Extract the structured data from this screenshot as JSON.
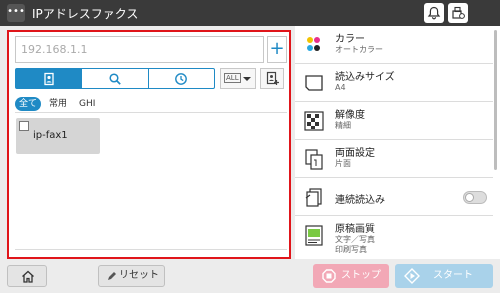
{
  "header": {
    "title": "IPアドレスファクス",
    "menu_icon": "ellipsis-icon",
    "right_icons": [
      "bell-icon",
      "fax-status-icon"
    ]
  },
  "address": {
    "input_value": "192.168.1.1",
    "add_label": "+"
  },
  "view_tabs": [
    {
      "icon": "address-book-icon",
      "active": true
    },
    {
      "icon": "search-icon",
      "active": false
    },
    {
      "icon": "clock-icon",
      "active": false
    }
  ],
  "index_dropdown": {
    "value": "ALL"
  },
  "filters": [
    {
      "label": "全て",
      "active": true
    },
    {
      "label": "常用",
      "active": false
    },
    {
      "label": "GHI",
      "active": false
    }
  ],
  "destinations": [
    {
      "name": "ip-fax1",
      "checked": false
    }
  ],
  "settings": [
    {
      "title": "カラー",
      "value": "オートカラー",
      "icon": "color-dots-icon"
    },
    {
      "title": "読込みサイズ",
      "value": "A4",
      "icon": "paper-size-icon"
    },
    {
      "title": "解像度",
      "value": "精細",
      "icon": "resolution-icon"
    },
    {
      "title": "両面設定",
      "value": "片面",
      "icon": "duplex-icon"
    },
    {
      "title": "連続読込み",
      "value": "",
      "icon": "continuous-scan-icon",
      "toggle": false
    },
    {
      "title": "原稿画質",
      "value": "文字／写真",
      "value2": "印刷写真",
      "icon": "image-quality-icon"
    }
  ],
  "footer": {
    "home_icon": "home-icon",
    "reset_label": "リセット",
    "stop_label": "ストップ",
    "start_label": "スタート"
  },
  "colors": {
    "accent": "#1f8ac5",
    "highlight_border": "#e0151a",
    "stop": "#f2a8b6",
    "start": "#a9d2ea"
  }
}
